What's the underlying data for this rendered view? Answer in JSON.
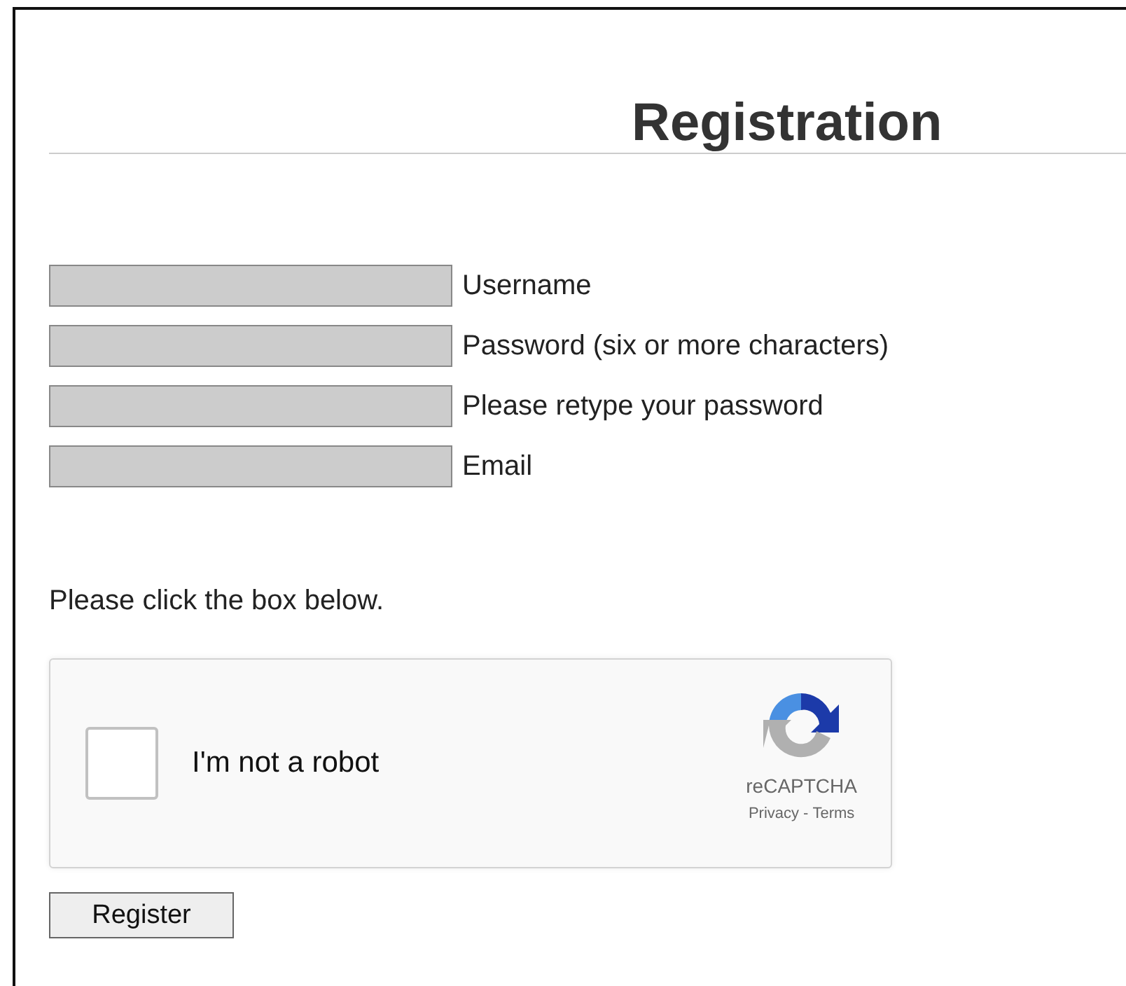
{
  "heading": "Registration",
  "fields": [
    {
      "label": "Username"
    },
    {
      "label": "Password (six or more characters)"
    },
    {
      "label": "Please retype your password"
    },
    {
      "label": "Email"
    }
  ],
  "instruction": "Please click the box below.",
  "captcha": {
    "label": "I'm not a robot",
    "checked": false,
    "brand": "reCAPTCHA",
    "links": [
      "Privacy",
      "Terms"
    ],
    "separator": "-"
  },
  "submit": "Register"
}
